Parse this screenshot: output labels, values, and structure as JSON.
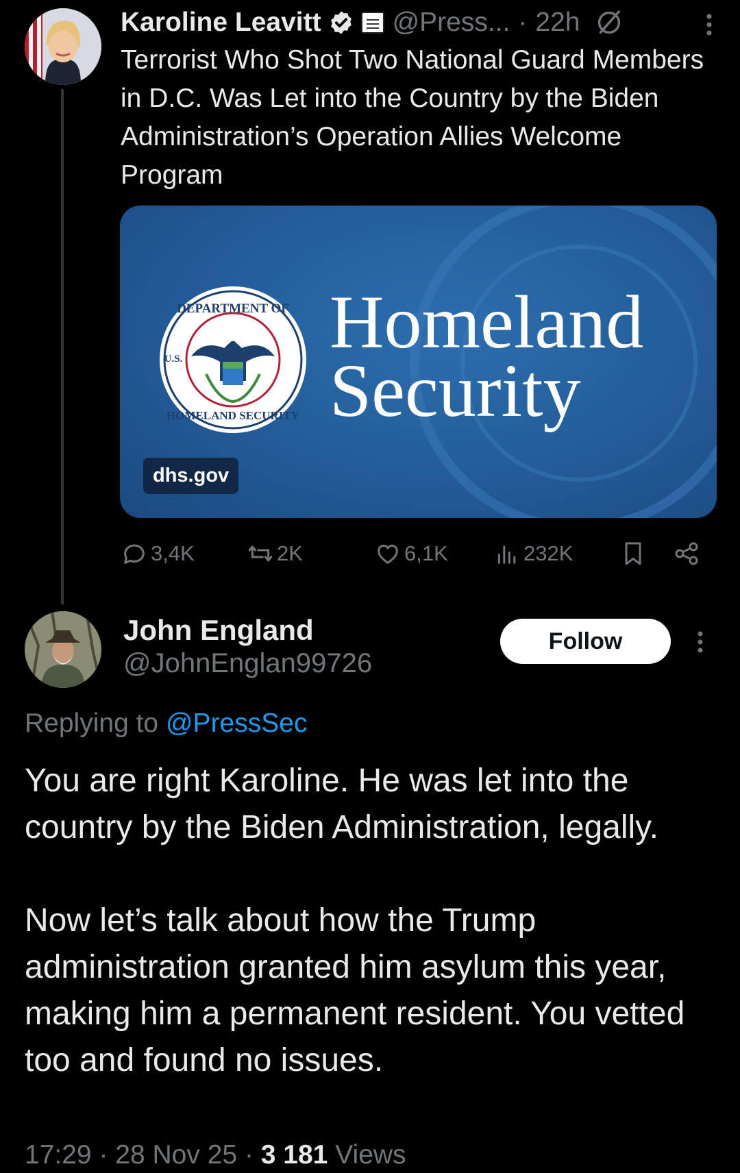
{
  "tweet": {
    "author_name": "Karoline Leavitt",
    "handle": "@Press...",
    "separator": "·",
    "time": "22h",
    "text": "Terrorist Who Shot Two National Guard Members in D.C. Was Let into the Country by the Biden Administration’s Operation Allies Welcome Program",
    "card": {
      "title_line1": "Homeland",
      "title_line2": "Security",
      "domain": "dhs.gov",
      "seal_top_text": "DEPARTMENT OF",
      "seal_bottom_text": "HOMELAND SECURITY",
      "seal_left_text": "U.S."
    },
    "stats": {
      "replies": "3,4K",
      "reposts": "2K",
      "likes": "6,1K",
      "views": "232K"
    }
  },
  "reply": {
    "author_name": "John England",
    "handle": "@JohnEnglan99726",
    "follow_label": "Follow",
    "replying_prefix": "Replying to",
    "replying_mention": "@PressSec",
    "paragraph1": "You are right Karoline. He was let into the country by the Biden Administration, legally.",
    "paragraph2": "Now let’s talk about how the Trump administration granted him asylum this year, making him a permanent resident. You vetted too and found no issues.",
    "time": "17:29",
    "date": "28 Nov 25",
    "separator": "·",
    "views_count": "3 181",
    "views_label": "Views"
  },
  "icons": [
    "verified-badge-icon",
    "white-house-badge-icon",
    "hidden-reply-icon",
    "more-icon",
    "reply-icon",
    "repost-icon",
    "like-icon",
    "views-icon",
    "bookmark-icon",
    "share-icon"
  ],
  "colors": {
    "background": "#000000",
    "text": "#e7e9ea",
    "secondary": "#71767b",
    "link": "#1d9bf0",
    "card_blue": "#235c99"
  }
}
